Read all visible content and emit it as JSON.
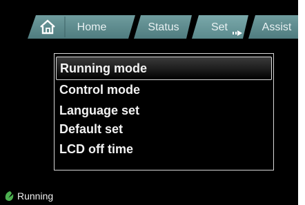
{
  "tabs": {
    "home_icon": "home-icon",
    "home_label": "Home",
    "status_label": "Status",
    "set_label": "Set",
    "assist_label": "Assist",
    "active_tab": "Set",
    "tab_color": "#5f8d8f"
  },
  "menu": {
    "items": [
      {
        "label": "Running mode",
        "selected": true
      },
      {
        "label": "Control mode",
        "selected": false
      },
      {
        "label": "Language set",
        "selected": false
      },
      {
        "label": "Default set",
        "selected": false
      },
      {
        "label": "LCD off time",
        "selected": false
      }
    ]
  },
  "status": {
    "icon": "leaf-icon",
    "icon_color": "#4caf50",
    "text": "Running"
  }
}
